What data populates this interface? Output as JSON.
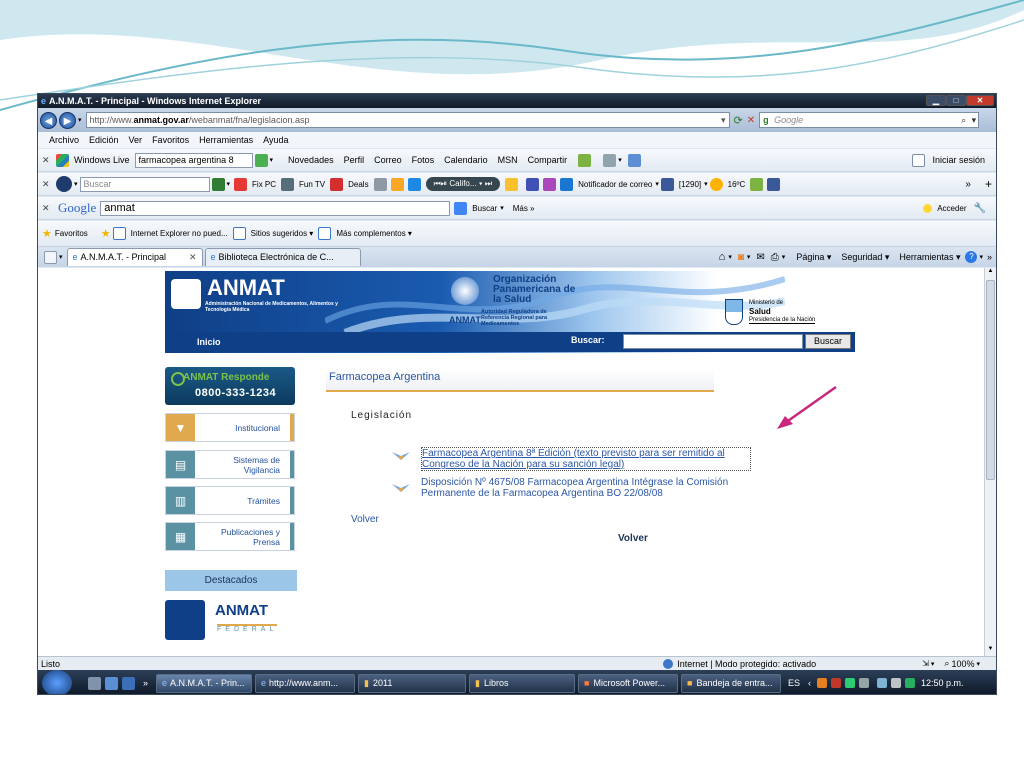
{
  "window": {
    "title": "A.N.M.A.T. - Principal - Windows Internet Explorer",
    "min": "▁",
    "max": "□",
    "close": "✕"
  },
  "address": {
    "url_prefix": "http://www.",
    "url_domain": "anmat.gov.ar",
    "url_path": "/webanmat/fna/legislacion.asp",
    "search_placeholder": "Google"
  },
  "menu": [
    "Archivo",
    "Edición",
    "Ver",
    "Favoritos",
    "Herramientas",
    "Ayuda"
  ],
  "live_toolbar": {
    "brand": "Windows Live",
    "query": "farmacopea argentina 8",
    "links": [
      "Novedades",
      "Perfil",
      "Correo",
      "Fotos",
      "Calendario",
      "MSN",
      "Compartir"
    ],
    "signin": "Iniciar sesión"
  },
  "ask_toolbar": {
    "search_placeholder": "Buscar",
    "items": [
      "Fix PC",
      "Fun TV",
      "Deals"
    ],
    "radio": "Califo...",
    "mail": "Notificador de correo",
    "count": "[1290]",
    "weather": "16ºC"
  },
  "google_toolbar": {
    "brand": "Google",
    "query": "anmat",
    "search": "Buscar",
    "more": "Más »",
    "signin": "Acceder"
  },
  "favorites_bar": {
    "favorites": "Favoritos",
    "items": [
      "Internet Explorer no pued...",
      "Sitios sugeridos ▾",
      "Más complementos ▾"
    ]
  },
  "tabs": {
    "active": "A.N.M.A.T. - Principal",
    "inactive": "Biblioteca Electrónica de C...",
    "commands": [
      "Página ▾",
      "Seguridad ▾",
      "Herramientas ▾"
    ]
  },
  "page": {
    "logo": "ANMAT",
    "logo_sub": "Administración Nacional de Medicamentos, Alimentos y Tecnología Médica",
    "ops_title": "Organización Panamericana de la Salud",
    "ops_anmat": "ANMAT",
    "ops_sub": "Autoridad Reguladora de Referencia Regional para Medicamentos",
    "ministerio_1": "Ministerio de",
    "ministerio_2": "Salud",
    "ministerio_3": "Presidencia de la Nación",
    "nav_inicio": "Inicio",
    "buscar_label": "Buscar:",
    "buscar_btn": "Buscar",
    "responde_title": "ANMAT Responde",
    "responde_phone": "0800-333-1234",
    "side_items": [
      "Institucional",
      "Sistemas de Vigilancia",
      "Trámites",
      "Publicaciones y Prensa"
    ],
    "destacados": "Destacados",
    "federal_title": "ANMAT",
    "federal_sub": "FEDERAL",
    "section_title": "Farmacopea Argentina",
    "subsection": "Legislación",
    "link1": "Farmacopea Argentina 8ª Edición (texto previsto para ser remitido al Congreso de la Nación para su sanción legal)",
    "link2": "Disposición Nº 4675/08 Farmacopea Argentina Intégrase la Comisión Permanente de la Farmacopea Argentina BO 22/08/08",
    "volver_left": "Volver",
    "volver_center": "Volver"
  },
  "status": {
    "left": "Listo",
    "zone": "Internet | Modo protegido: activado",
    "zoom": "100%"
  },
  "taskbar": {
    "items": [
      "A.N.M.A.T. - Prin...",
      "http://www.anm...",
      "2011",
      "Libros",
      "Microsoft Power...",
      "Bandeja de entra..."
    ],
    "lang": "ES",
    "time": "12:50 p.m."
  },
  "colors": {
    "accent": "#0f3f86",
    "link": "#2c57a6",
    "sidebar_teal": "#5b92a3",
    "arrow": "#c8277c"
  }
}
